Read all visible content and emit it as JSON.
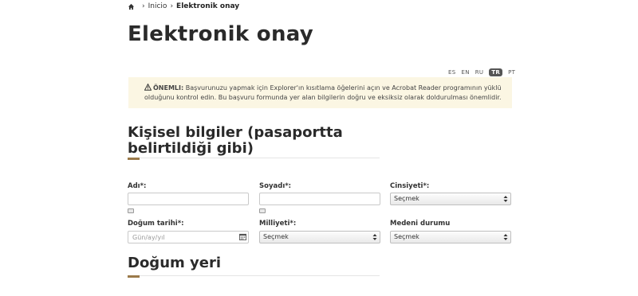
{
  "breadcrumb": {
    "home_icon": "home-icon",
    "items": [
      {
        "label": "Inicio"
      },
      {
        "label": "Elektronik onay"
      }
    ]
  },
  "page": {
    "title": "Elektronik onay"
  },
  "languages": [
    {
      "code": "ES",
      "active": false
    },
    {
      "code": "EN",
      "active": false
    },
    {
      "code": "RU",
      "active": false
    },
    {
      "code": "TR",
      "active": true
    },
    {
      "code": "PT",
      "active": false
    }
  ],
  "notice": {
    "icon": "warning-icon",
    "strong": "ÖNEMLI:",
    "line1": "Başvurunuzu yapmak için Explorer'ın kısıtlama öğelerini açın ve Acrobat Reader programının yüklü",
    "line2": "olduğunu kontrol edin. Bu başvuru formunda yer alan bilgilerin doğru ve eksiksiz olarak doldurulması önemlidir."
  },
  "personal": {
    "title": "Kişisel bilgiler (pasaportta belirtildiği gibi)",
    "first_name": {
      "label": "Adı*:",
      "value": ""
    },
    "last_name": {
      "label": "Soyadı*:",
      "value": ""
    },
    "gender": {
      "label": "Cinsiyeti*:",
      "selected": "Seçmek"
    },
    "birth_date": {
      "label": "Doğum tarihi*:",
      "placeholder": "Gün/ay/yıl"
    },
    "nationality": {
      "label": "Milliyeti*:",
      "selected": "Seçmek"
    },
    "marital_status": {
      "label": "Medeni durumu",
      "selected": "Seçmek"
    }
  },
  "birthplace": {
    "title": "Doğum yeri"
  },
  "colors": {
    "accent": "#9b7a4a",
    "notice_bg": "#fbf6e3"
  }
}
